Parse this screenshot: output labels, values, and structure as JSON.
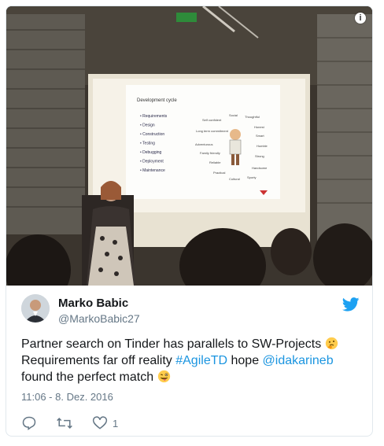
{
  "slide": {
    "title": "Development cycle",
    "items": [
      "Requirements",
      "Design",
      "Construction",
      "Testing",
      "Debugging",
      "Deployment",
      "Maintenance"
    ],
    "traits": [
      "Social",
      "Thoughtful",
      "Self confident",
      "Honest",
      "Long term commitment",
      "Smart",
      "Adventurous",
      "Humble",
      "Family friendly",
      "Strong",
      "Reliable",
      "Handsome",
      "Practical",
      "Cultural",
      "Sporty"
    ]
  },
  "tweet": {
    "name": "Marko Babic",
    "handle": "@MarkoBabic27",
    "text_part1": "Partner search on Tinder has parallels to SW-Projects ",
    "text_part2": " Requirements far off reality ",
    "hashtag": "#AgileTD",
    "text_part3": " hope ",
    "mention": "@idakarineb",
    "text_part4": " found the perfect match ",
    "timestamp": "11:06 - 8. Dez. 2016",
    "like_count": "1"
  },
  "colors": {
    "link": "#1b95e0",
    "muted": "#657786",
    "text": "#14171a",
    "twitter_blue": "#1da1f2"
  },
  "icons": {
    "info": "info-icon",
    "twitter": "twitter-bird-icon",
    "reply": "reply-icon",
    "retweet": "retweet-icon",
    "like": "heart-icon",
    "thinking": "thinking-face-emoji",
    "wink": "winking-tongue-emoji"
  }
}
